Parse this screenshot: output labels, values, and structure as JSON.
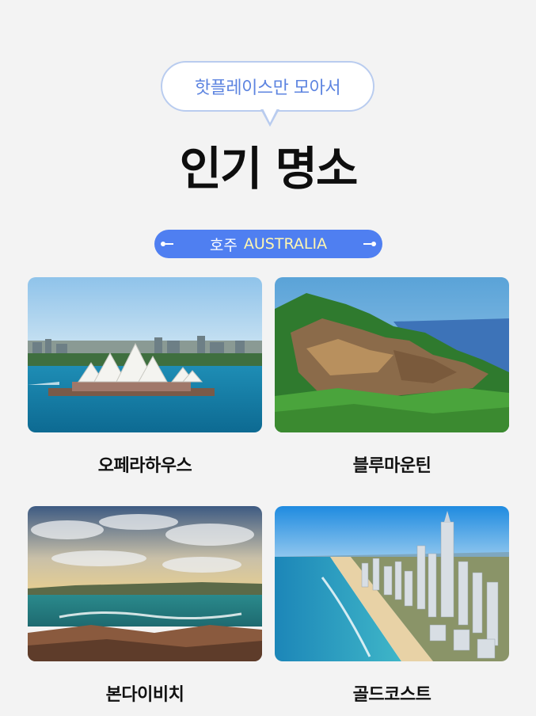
{
  "header": {
    "subtitle": "핫플레이스만 모아서",
    "title": "인기 명소"
  },
  "region": {
    "korean": "호주",
    "english": "AUSTRALIA"
  },
  "places": [
    {
      "name": "오페라하우스"
    },
    {
      "name": "블루마운틴"
    },
    {
      "name": "본다이비치"
    },
    {
      "name": "골드코스트"
    }
  ],
  "colors": {
    "background": "#f3f3f3",
    "accent_blue": "#4f7ff1",
    "subtitle_blue": "#5d84e0",
    "english_highlight": "#fff6b0"
  }
}
